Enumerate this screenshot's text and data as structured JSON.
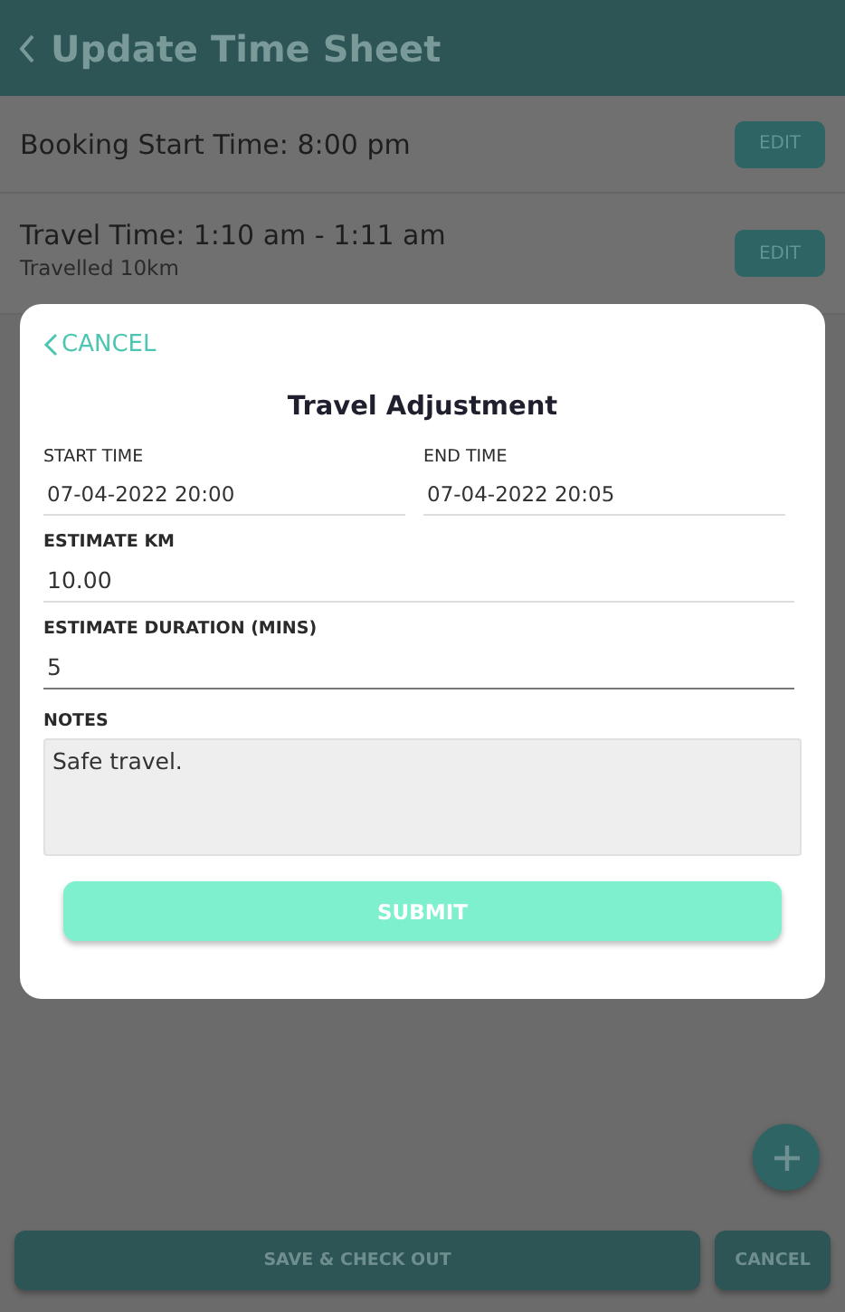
{
  "header": {
    "title": "Update Time Sheet"
  },
  "entries": [
    {
      "label": "Booking Start Time:",
      "value": "8:00 pm",
      "edit": "EDIT"
    },
    {
      "label": "Travel Time:",
      "value": "1:10 am - 1:11 am",
      "note": "Travelled 10km",
      "edit": "EDIT"
    }
  ],
  "dialog": {
    "cancel": "CANCEL",
    "title": "Travel Adjustment",
    "fields": [
      {
        "kind": "half",
        "label": "START TIME",
        "value": "07-04-2022 20:00",
        "focused": false
      },
      {
        "kind": "half",
        "label": "END TIME",
        "value": "07-04-2022 20:05",
        "focused": false
      },
      {
        "kind": "full",
        "label": "ESTIMATE KM",
        "value": "10.00",
        "focused": false
      },
      {
        "kind": "full",
        "label": "ESTIMATE DURATION (MINS)",
        "value": "5",
        "focused": true
      }
    ],
    "notes": {
      "label": "NOTES",
      "value": "Safe travel."
    },
    "submit": "SUBMIT"
  },
  "footer": {
    "primary": "SAVE & CHECK OUT",
    "secondary": "CANCEL"
  }
}
